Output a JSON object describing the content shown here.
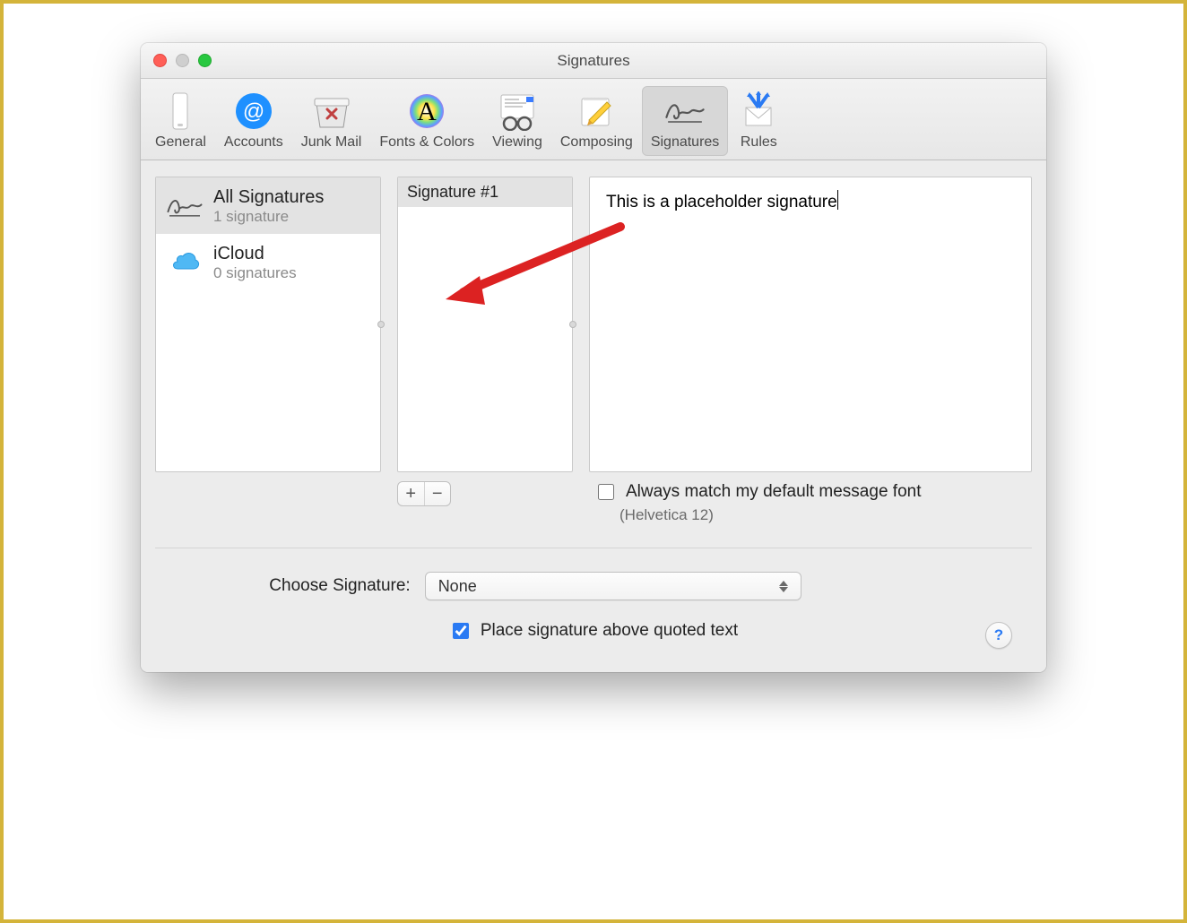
{
  "window": {
    "title": "Signatures"
  },
  "toolbar": {
    "items": [
      {
        "label": "General"
      },
      {
        "label": "Accounts"
      },
      {
        "label": "Junk Mail"
      },
      {
        "label": "Fonts & Colors"
      },
      {
        "label": "Viewing"
      },
      {
        "label": "Composing"
      },
      {
        "label": "Signatures"
      },
      {
        "label": "Rules"
      }
    ]
  },
  "accounts": {
    "items": [
      {
        "title": "All Signatures",
        "subtitle": "1 signature"
      },
      {
        "title": "iCloud",
        "subtitle": "0 signatures"
      }
    ]
  },
  "signatureList": {
    "items": [
      {
        "name": "Signature #1"
      }
    ]
  },
  "editor": {
    "text": "This is a placeholder signature"
  },
  "options": {
    "matchFontLabel": "Always match my default message font",
    "matchFontNote": "(Helvetica 12)",
    "matchFontChecked": false
  },
  "choose": {
    "label": "Choose Signature:",
    "value": "None"
  },
  "placeAbove": {
    "label": "Place signature above quoted text",
    "checked": true
  },
  "buttons": {
    "plus": "+",
    "minus": "−",
    "help": "?"
  }
}
